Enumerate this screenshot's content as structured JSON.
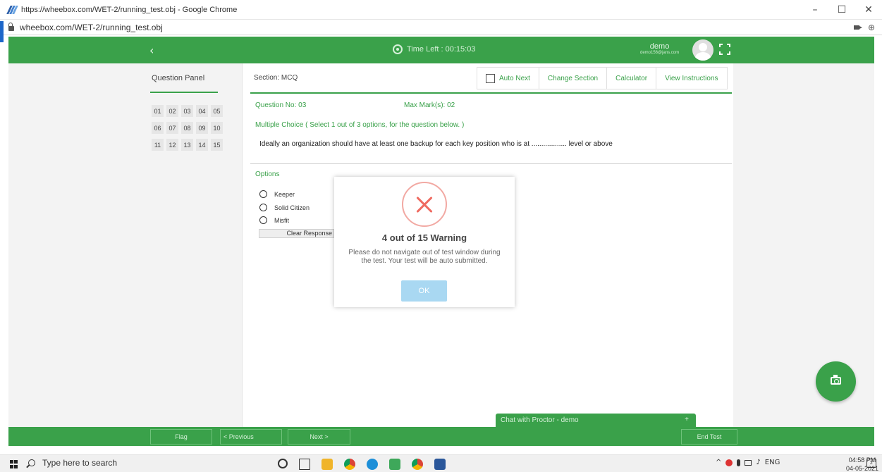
{
  "browser": {
    "window_title": "https://wheebox.com/WET-2/running_test.obj - Google Chrome",
    "address": "wheebox.com/WET-2/running_test.obj",
    "minimize": "–",
    "maximize": "☐",
    "close": "✕",
    "zoom_icon_glyph": "⊕"
  },
  "header": {
    "back": "‹",
    "timer_label": "Time Left : 00:15:03",
    "user_name": "demo",
    "user_email": "demo156@jans.com"
  },
  "question_panel": {
    "title": "Question Panel",
    "numbers": [
      "01",
      "02",
      "03",
      "04",
      "05",
      "06",
      "07",
      "08",
      "09",
      "10",
      "11",
      "12",
      "13",
      "14",
      "15"
    ]
  },
  "toolbar": {
    "section_label": "Section: MCQ",
    "auto_next": "Auto Next",
    "change_section": "Change Section",
    "calculator": "Calculator",
    "view_instructions": "View Instructions"
  },
  "question": {
    "number": "Question No: 03",
    "max_marks": "Max Mark(s): 02",
    "type": "Multiple Choice ( Select 1 out of 3 options, for the question below. )",
    "text": "Ideally an organization should have at least one backup for each key position who is at .................. level or above",
    "options_title": "Options",
    "options": [
      "Keeper",
      "Solid Citizen",
      "Misfit"
    ],
    "clear_response": "Clear Response"
  },
  "modal": {
    "title": "4 out of 15 Warning",
    "message": "Please do not navigate out of test window during the test. Your test will be auto submitted.",
    "ok": "OK"
  },
  "chat": {
    "label": "Chat with Proctor - demo",
    "plus": "+"
  },
  "bottom_bar": {
    "flag": "Flag",
    "previous": "< Previous",
    "next": "Next >",
    "end_test": "End Test"
  },
  "taskbar": {
    "search_placeholder": "Type here to search",
    "language": "ENG",
    "time": "04:58 PM",
    "date": "04-05-2021",
    "notifications": "2"
  }
}
